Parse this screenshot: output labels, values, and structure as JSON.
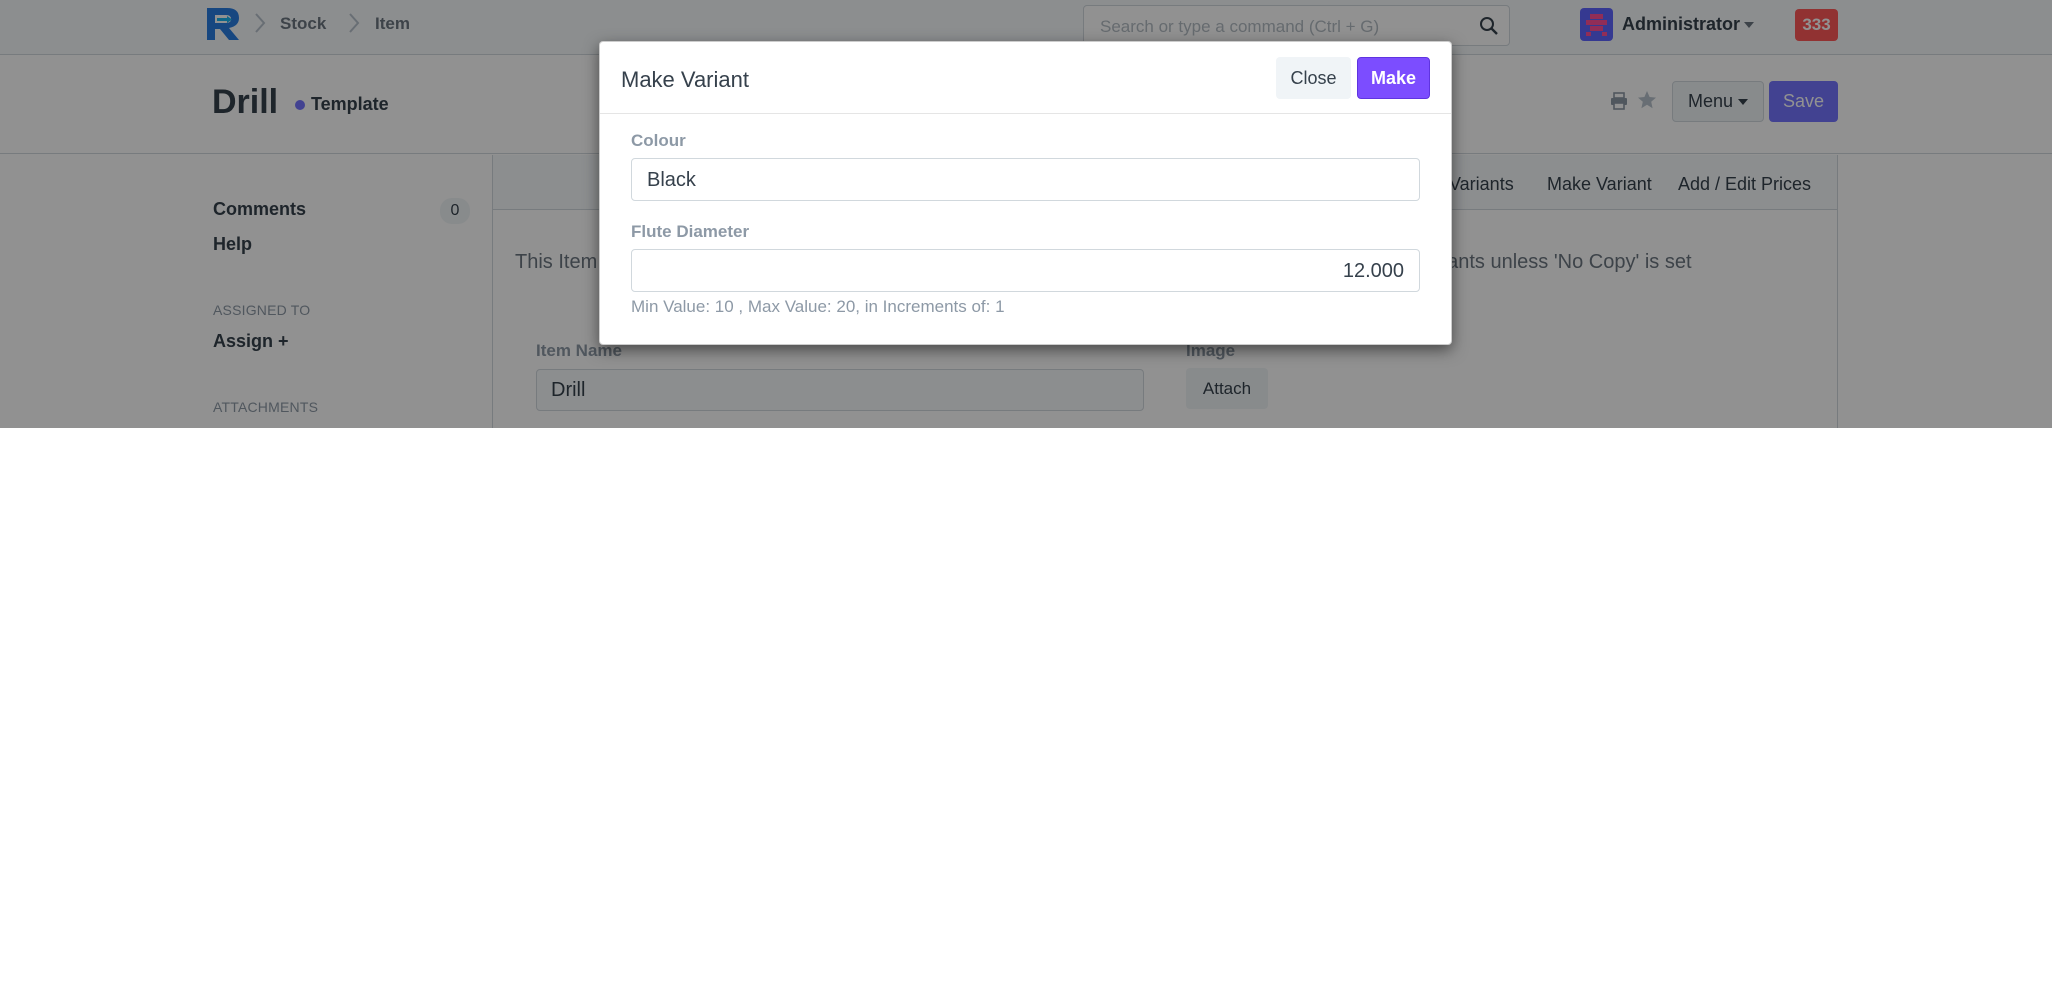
{
  "navbar": {
    "breadcrumbs": [
      "Stock",
      "Item"
    ],
    "search_placeholder": "Search or type a command (Ctrl + G)",
    "user": "Administrator",
    "notification_count": "333"
  },
  "page_head": {
    "title": "Drill",
    "status": "Template",
    "menu_label": "Menu",
    "save_label": "Save"
  },
  "sidebar": {
    "comments_label": "Comments",
    "comments_count": "0",
    "help_label": "Help",
    "assigned_to_heading": "ASSIGNED TO",
    "assign_label": "Assign +",
    "attachments_heading": "ATTACHMENTS"
  },
  "form": {
    "toolbar": {
      "variants_label": "Variants",
      "make_variant_label": "Make Variant",
      "prices_label": "Add / Edit Prices"
    },
    "notice_start": "This Item",
    "notice_end": "riants unless 'No Copy' is set",
    "item_name_label": "Item Name",
    "item_name_value": "Drill",
    "image_label": "Image",
    "attach_label": "Attach"
  },
  "modal": {
    "title": "Make Variant",
    "close_label": "Close",
    "make_label": "Make",
    "fields": [
      {
        "label": "Colour",
        "value": "Black"
      },
      {
        "label": "Flute Diameter",
        "value": "12.000"
      }
    ],
    "help_text": "Min Value: 10 , Max Value: 20, in Increments of: 1"
  },
  "colors": {
    "primary": "#7575ff",
    "make_button": "#7c4dff",
    "notification": "#ff5858"
  }
}
